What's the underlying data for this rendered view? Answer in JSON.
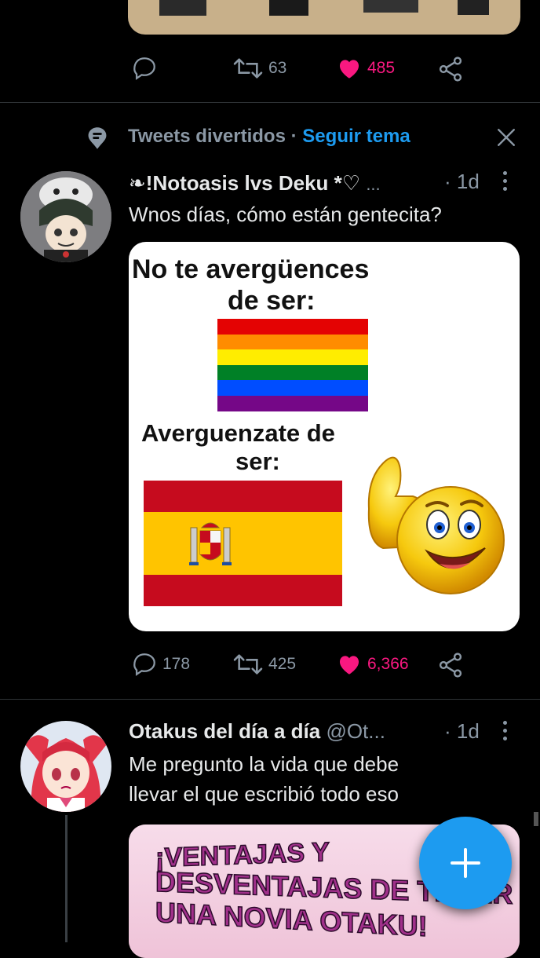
{
  "top_tweet": {
    "replies": "",
    "retweets": "63",
    "likes": "485"
  },
  "topic_header": {
    "topic": "Tweets divertidos",
    "separator": "·",
    "follow_label": "Seguir tema"
  },
  "tweet1": {
    "display_name": "❧!Notoasis lvs Deku *♡",
    "handle": "...",
    "time": "· 1d",
    "text": "Wnos días, cómo están gentecita?",
    "meme": {
      "line1": "No te avergüences",
      "line2": "de ser:",
      "line3": "Averguenzate de",
      "line4": "ser:"
    },
    "replies": "178",
    "retweets": "425",
    "likes": "6,366"
  },
  "tweet2": {
    "display_name": "Otakus del día a día",
    "handle": "@Ot...",
    "time": "· 1d",
    "text_line1": "Me pregunto la vida que debe",
    "text_line2": "llevar el que escribió todo eso",
    "meme": {
      "line1": "¡VENTAJAS Y",
      "line2": "DESVENTAJAS DE TENER",
      "line3": "UNA NOVIA OTAKU!"
    }
  },
  "colors": {
    "accent": "#1d9bf0",
    "like": "#f91880",
    "muted": "#8b98a5",
    "divider": "#2f3336"
  },
  "icons": [
    "reply-icon",
    "retweet-icon",
    "heart-icon",
    "share-icon",
    "topic-icon",
    "close-icon",
    "more-icon",
    "compose-plus-icon"
  ]
}
